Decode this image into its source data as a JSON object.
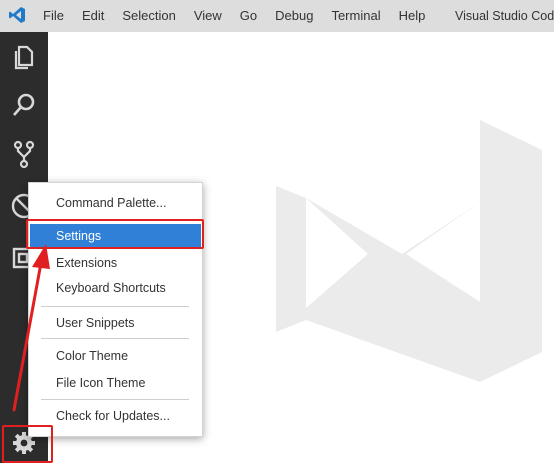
{
  "titlebar": {
    "logo_icon": "vscode-logo-icon",
    "menu": [
      "File",
      "Edit",
      "Selection",
      "View",
      "Go",
      "Debug",
      "Terminal",
      "Help"
    ],
    "window_title": "Visual Studio Code"
  },
  "activitybar": {
    "icons": [
      "files-icon",
      "search-icon",
      "source-control-icon",
      "debug-icon",
      "extensions-icon",
      "gear-icon"
    ]
  },
  "context_menu": {
    "items": [
      {
        "label": "Command Palette..."
      },
      {
        "label": "Settings",
        "highlighted": true
      },
      {
        "label": "Extensions"
      },
      {
        "label": "Keyboard Shortcuts"
      },
      {
        "label": "User Snippets"
      },
      {
        "label": "Color Theme"
      },
      {
        "label": "File Icon Theme"
      },
      {
        "label": "Check for Updates..."
      }
    ]
  },
  "colors": {
    "titlebar_bg": "#dddddd",
    "activitybar_bg": "#2c2c2c",
    "selection_bg": "#2f80d6",
    "annotation_red": "#e02020",
    "watermark": "#ebebeb"
  }
}
